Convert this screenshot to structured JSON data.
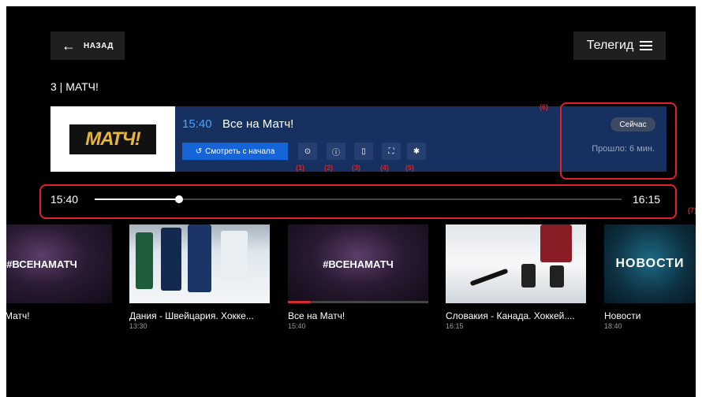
{
  "header": {
    "back_label": "НАЗАД",
    "guide_label": "Телегид"
  },
  "channel": {
    "title": "3 | МАТЧ!",
    "logo_text": "МАТЧ!"
  },
  "program": {
    "time": "15:40",
    "name": "Все на Матч!",
    "watch_label": "Смотреть с начала",
    "status_badge": "Сейчас",
    "elapsed": "Прошло: 6 мин."
  },
  "controls": [
    {
      "icon": "record-icon",
      "glyph": "⊙"
    },
    {
      "icon": "info-icon",
      "glyph": "ⓘ"
    },
    {
      "icon": "bookmark-icon",
      "glyph": "▯"
    },
    {
      "icon": "fullscreen-icon",
      "glyph": "⛶"
    },
    {
      "icon": "settings-icon",
      "glyph": "✱"
    }
  ],
  "markers": [
    "(1)",
    "(2)",
    "(3)",
    "(4)",
    "(5)",
    "(6)",
    "(7)"
  ],
  "timeline": {
    "start": "15:40",
    "end": "16:15",
    "progress": 0.16
  },
  "carousel": [
    {
      "title": "Матч!",
      "time": "",
      "image_text": "#ВСЕНАМАТЧ",
      "progress": 0
    },
    {
      "title": "Дания - Швейцария. Хокке...",
      "time": "13:30",
      "image_text": "",
      "progress": 0
    },
    {
      "title": "Все на Матч!",
      "time": "15:40",
      "image_text": "#ВСЕНАМАТЧ",
      "progress": 0.16
    },
    {
      "title": "Словакия - Канада. Хоккей....",
      "time": "16:15",
      "image_text": "",
      "progress": 0
    },
    {
      "title": "Новости",
      "time": "18:40",
      "image_text": "НОВОСТИ",
      "progress": 0
    }
  ],
  "colors": {
    "accent": "#1565d8",
    "time_highlight": "#4aa3ff",
    "card_bg": "#16315f",
    "annotation_red": "#e0202a"
  }
}
